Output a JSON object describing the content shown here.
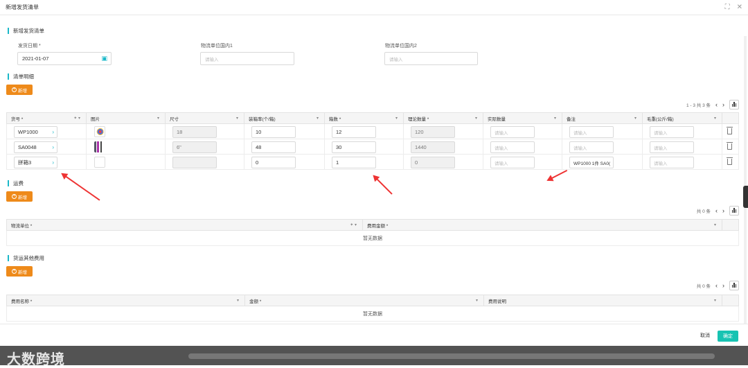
{
  "window": {
    "title": "新增发货清单"
  },
  "form": {
    "section_title": "新增发货清单",
    "ship_date_label": "发货日期 *",
    "ship_date_value": "2021-01-07",
    "logistics1_label": "物流单位国内1",
    "logistics1_placeholder": "请输入",
    "logistics2_label": "物流单位国内2",
    "logistics2_placeholder": "请输入"
  },
  "detail": {
    "section_title": "清单明细",
    "add_label": "新增",
    "pager": {
      "text": "1 - 3 共 3 条"
    },
    "columns": [
      "货号 *",
      "图片",
      "尺寸",
      "装箱率(个/箱)",
      "箱数 *",
      "理论数量 *",
      "实际数量",
      "备注",
      "毛重(公斤/箱)"
    ],
    "rows": [
      {
        "sku": "WP1000",
        "size": "18",
        "rate": "10",
        "boxes": "12",
        "theory": "120",
        "actual_ph": "请输入",
        "remark": "",
        "remark_ph": "请输入",
        "weight_ph": "请输入"
      },
      {
        "sku": "SA0048",
        "size": "6\"",
        "rate": "48",
        "boxes": "30",
        "theory": "1440",
        "actual_ph": "请输入",
        "remark": "",
        "remark_ph": "请输入",
        "weight_ph": "请输入"
      },
      {
        "sku": "拼箱3",
        "size": "",
        "rate": "0",
        "boxes": "1",
        "theory": "0",
        "actual_ph": "请输入",
        "remark": "WP1000 1件 SA0(",
        "remark_ph": "",
        "weight_ph": "请输入"
      }
    ]
  },
  "freight": {
    "section_title": "运费",
    "add_label": "新增",
    "pager": {
      "text": "共 0 条"
    },
    "columns": [
      "物流单位 *",
      "费用金额 *"
    ],
    "empty": "暂无数据"
  },
  "other": {
    "section_title": "货运其他费用",
    "add_label": "新增",
    "pager": {
      "text": "共 0 条"
    },
    "columns": [
      "费用名称 *",
      "金额 *",
      "费用说明"
    ],
    "empty": "暂无数据"
  },
  "footer": {
    "cancel_label": "取消",
    "ok_label": "确定"
  },
  "watermark": "大数跨境",
  "colors": {
    "accent": "#17c3b2",
    "add_button": "#ee8a1a",
    "annotation_arrow": "#e33333"
  }
}
